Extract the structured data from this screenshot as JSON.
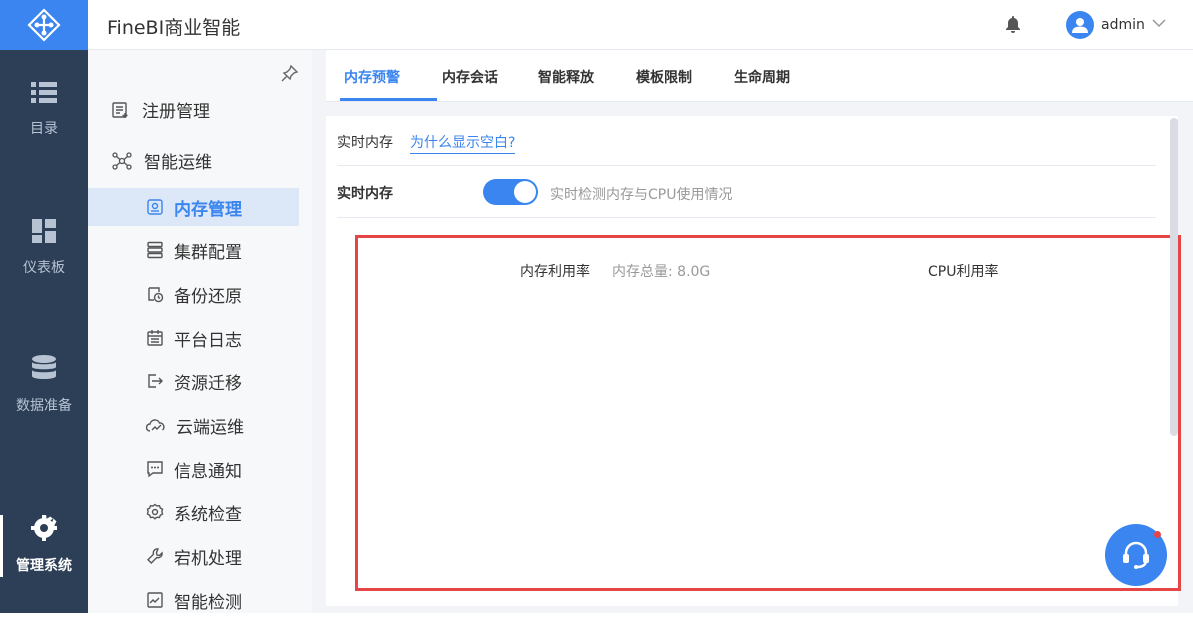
{
  "app": {
    "title": "FineBI商业智能"
  },
  "user": {
    "name": "admin"
  },
  "rail": {
    "items": [
      {
        "label": "目录",
        "icon": "list-icon"
      },
      {
        "label": "仪表板",
        "icon": "dashboard-icon"
      },
      {
        "label": "数据准备",
        "icon": "database-icon"
      },
      {
        "label": "管理系统",
        "icon": "gear-icon",
        "active": true
      }
    ]
  },
  "sidebar": {
    "groups": [
      {
        "label": "注册管理",
        "icon": "register-icon"
      },
      {
        "label": "智能运维",
        "icon": "network-icon"
      }
    ],
    "items": [
      {
        "label": "内存管理",
        "icon": "memory-icon",
        "active": true
      },
      {
        "label": "集群配置",
        "icon": "cluster-icon"
      },
      {
        "label": "备份还原",
        "icon": "backup-icon"
      },
      {
        "label": "平台日志",
        "icon": "log-icon"
      },
      {
        "label": "资源迁移",
        "icon": "migrate-icon"
      },
      {
        "label": "云端运维",
        "icon": "cloud-icon"
      },
      {
        "label": "信息通知",
        "icon": "message-icon"
      },
      {
        "label": "系统检查",
        "icon": "settings-check-icon"
      },
      {
        "label": "宕机处理",
        "icon": "wrench-icon"
      },
      {
        "label": "智能检测",
        "icon": "monitor-icon"
      }
    ]
  },
  "tabs": [
    {
      "label": "内存预警",
      "active": true
    },
    {
      "label": "内存会话"
    },
    {
      "label": "智能释放"
    },
    {
      "label": "模板限制"
    },
    {
      "label": "生命周期"
    }
  ],
  "realtime": {
    "label": "实时内存",
    "link": "为什么显示空白?",
    "title": "实时内存",
    "toggle_on": true,
    "description": "实时检测内存与CPU使用情况"
  },
  "charts": {
    "memory_label": "内存利用率",
    "memory_total": "内存总量: 8.0G",
    "cpu_label": "CPU利用率"
  },
  "colors": {
    "primary": "#3a85f0",
    "rail": "#2d3f57",
    "highlight": "#e64545"
  }
}
